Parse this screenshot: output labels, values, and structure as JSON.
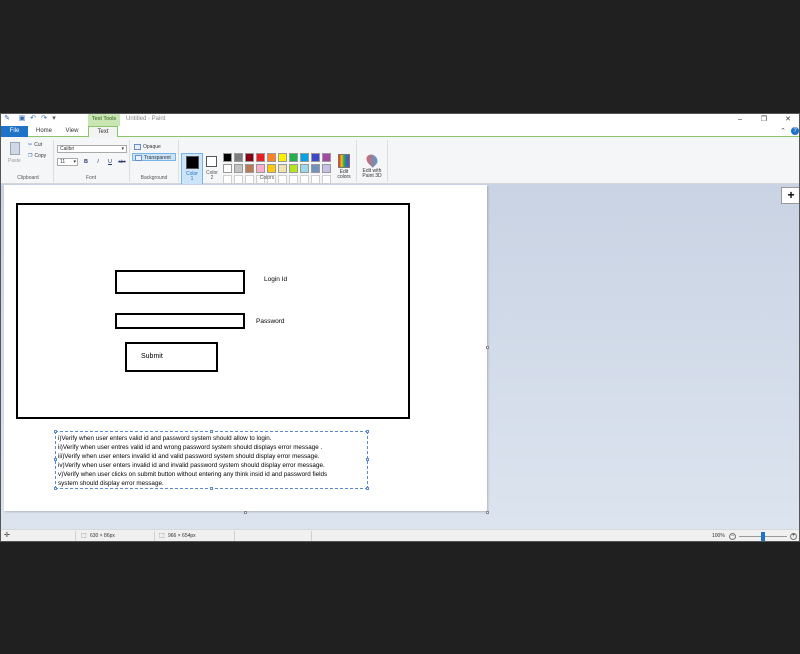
{
  "titlebar": {
    "contextual_tab": "Text Tools",
    "document_title": "Untitled - Paint",
    "window_controls": [
      "–",
      "❐",
      "✕"
    ]
  },
  "tabs": [
    {
      "label": "File"
    },
    {
      "label": "Home"
    },
    {
      "label": "View"
    },
    {
      "label": "Text"
    }
  ],
  "ribbon": {
    "clipboard": {
      "paste_label": "Paste",
      "cut_label": "Cut",
      "copy_label": "Copy",
      "group_label": "Clipboard"
    },
    "font": {
      "family": "Calibri",
      "size": "11",
      "bold": "B",
      "italic": "I",
      "underline": "U",
      "strike": "abc",
      "group_label": "Font"
    },
    "background": {
      "opaque_label": "Opaque",
      "transparent_label": "Transparent",
      "group_label": "Background"
    },
    "colors": {
      "color1_label_a": "Color",
      "color1_label_b": "1",
      "color2_label_a": "Color",
      "color2_label_b": "2",
      "edit_colors_a": "Edit",
      "edit_colors_b": "colors",
      "paint3d_a": "Edit with",
      "paint3d_b": "Paint 3D",
      "group_label": "Colors",
      "color1": "#000000",
      "color2": "#ffffff",
      "palette_row1": [
        "#000000",
        "#7f7f7f",
        "#880015",
        "#ed1c24",
        "#ff7f27",
        "#fff200",
        "#22b14c",
        "#00a2e8",
        "#3f48cc",
        "#a349a4"
      ],
      "palette_row2": [
        "#ffffff",
        "#c3c3c3",
        "#b97a57",
        "#ffaec9",
        "#ffc90e",
        "#efe4b0",
        "#b5e61d",
        "#99d9ea",
        "#7092be",
        "#c8bfe7"
      ]
    }
  },
  "canvas": {
    "login_label": "Login Id",
    "password_label": "Password",
    "submit_label": "Submit",
    "text_lines": [
      "i)Verify when user enters valid id and password system should allow to login.",
      "ii)Verify when user entres valid id and wrong password system should displays error message .",
      "iii)Verify when user enters invalid id and valid password system should display error message.",
      "iv)Verify when user enters invalid id and invalid password system should display error message.",
      "v)Verify when user clicks on submit button without entering any think insid id and password fields",
      "system should display error message."
    ]
  },
  "statusbar": {
    "selection_size": "630 × 86px",
    "image_size": "966 × 654px",
    "zoom": "100%"
  }
}
